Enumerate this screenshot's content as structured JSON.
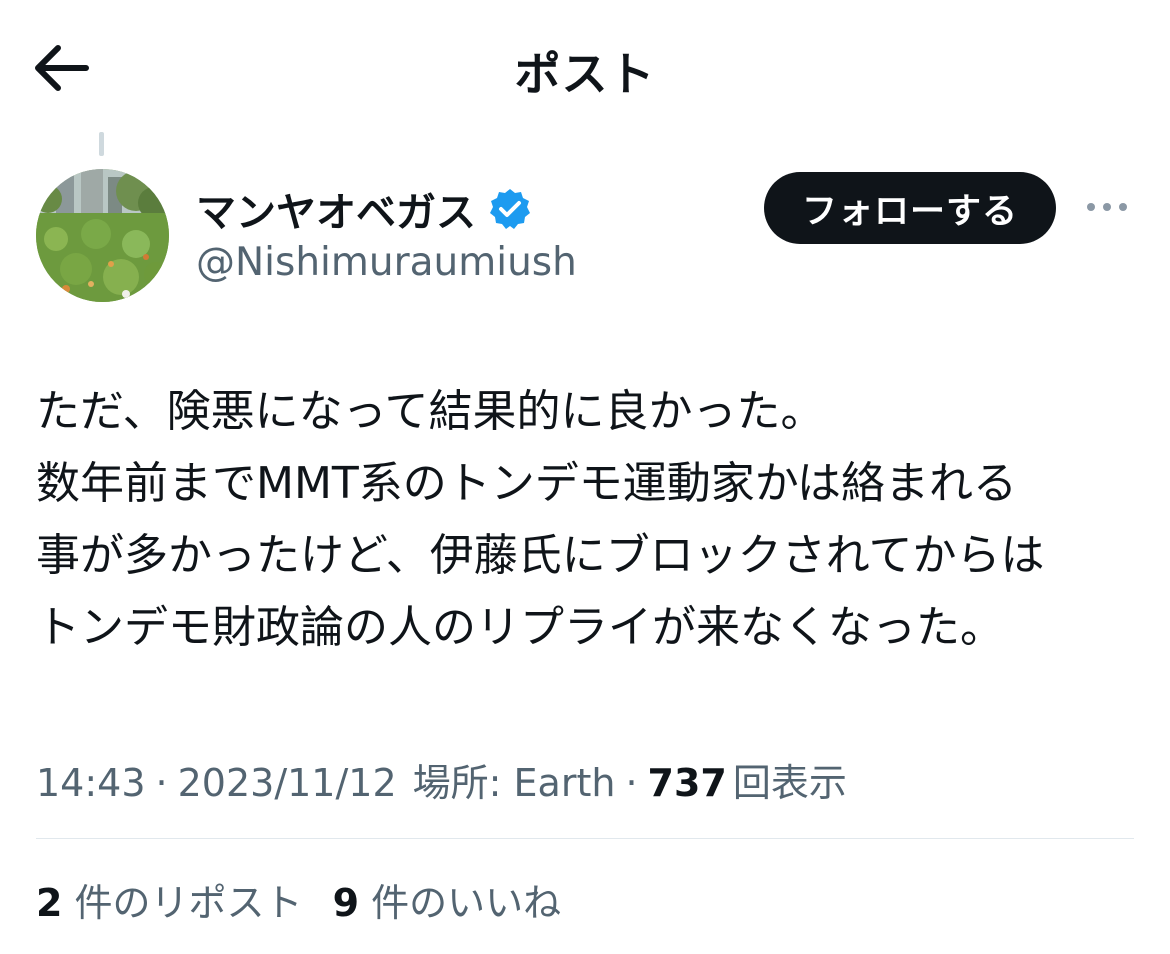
{
  "header": {
    "title": "ポスト",
    "back_icon": "arrow-left-icon"
  },
  "author": {
    "display_name": "マンヤオベガス",
    "handle": "@Nishimuraumiush",
    "verified": true,
    "verified_color": "#1d9bf0",
    "follow_label": "フォローする",
    "more_icon": "more-horizontal-icon"
  },
  "tweet": {
    "lines": [
      "ただ、険悪になって結果的に良かった。",
      "数年前までMMT系のトンデモ運動家かは絡まれる",
      "事が多かったけど、伊藤氏にブロックされてからは",
      "トンデモ財政論の人のリプライが来なくなった。"
    ]
  },
  "meta": {
    "time": "14:43",
    "date": "2023/11/12",
    "location": "場所: Earth",
    "views_count": "737",
    "views_label": "回表示",
    "separator": "·"
  },
  "stats": {
    "reposts_count": "2",
    "reposts_label": "件のリポスト",
    "likes_count": "9",
    "likes_label": "件のいいね"
  },
  "colors": {
    "text_primary": "#0f1419",
    "text_secondary": "#536471",
    "follow_button_bg": "#0f1419",
    "divider": "#e1e8ed"
  }
}
